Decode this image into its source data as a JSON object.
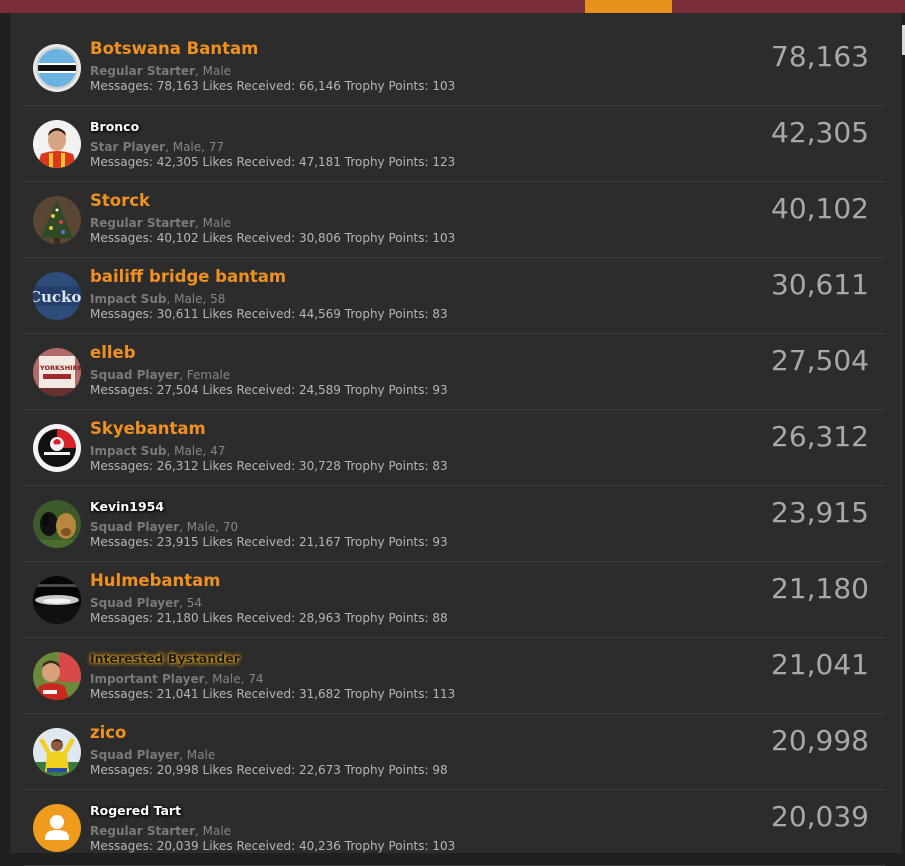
{
  "members": [
    {
      "name": "Botswana Bantam",
      "style": "plain",
      "rank": "Regular Starter",
      "details": ", Male",
      "stats": "Messages: 78,163 Likes Received: 66,146 Trophy Points: 103",
      "count": "78,163",
      "avatar": "botswana-flag"
    },
    {
      "name": "Bronco",
      "style": "white",
      "rank": "Star Player",
      "details": ", Male, 77",
      "stats": "Messages: 42,305 Likes Received: 47,181 Trophy Points: 123",
      "count": "42,305",
      "avatar": "portrait"
    },
    {
      "name": "Storck",
      "style": "plain",
      "rank": "Regular Starter",
      "details": ", Male",
      "stats": "Messages: 40,102 Likes Received: 30,806 Trophy Points: 103",
      "count": "40,102",
      "avatar": "christmas-tree"
    },
    {
      "name": "bailiff bridge bantam",
      "style": "plain",
      "rank": "Impact Sub",
      "details": ", Male, 58",
      "stats": "Messages: 30,611 Likes Received: 44,569 Trophy Points: 83",
      "count": "30,611",
      "avatar": "cuckoo-text",
      "avatar_text": "Cuckoo"
    },
    {
      "name": "elleb",
      "style": "plain",
      "rank": "Squad Player",
      "details": ", Female",
      "stats": "Messages: 27,504 Likes Received: 24,589 Trophy Points: 93",
      "count": "27,504",
      "avatar": "yorkshire-sign",
      "avatar_text": "YORKSHIRE"
    },
    {
      "name": "Skyebantam",
      "style": "plain",
      "rank": "Impact Sub",
      "details": ", Male, 47",
      "stats": "Messages: 26,312 Likes Received: 30,728 Trophy Points: 83",
      "count": "26,312",
      "avatar": "club-crest"
    },
    {
      "name": "Kevin1954",
      "style": "white",
      "rank": "Squad Player",
      "details": ", Male, 70",
      "stats": "Messages: 23,915 Likes Received: 21,167 Trophy Points: 93",
      "count": "23,915",
      "avatar": "dogs"
    },
    {
      "name": "Hulmebantam",
      "style": "plain",
      "rank": "Squad Player",
      "details": ", 54",
      "stats": "Messages: 21,180 Likes Received: 28,963 Trophy Points: 88",
      "count": "21,180",
      "avatar": "moonlit-sea"
    },
    {
      "name": "Interested Bystander",
      "style": "gold",
      "rank": "Important Player",
      "details": ", Male, 74",
      "stats": "Messages: 21,041 Likes Received: 31,682 Trophy Points: 113",
      "count": "21,041",
      "avatar": "football-fan"
    },
    {
      "name": "zico",
      "style": "plain",
      "rank": "Squad Player",
      "details": ", Male",
      "stats": "Messages: 20,998 Likes Received: 22,673 Trophy Points: 98",
      "count": "20,998",
      "avatar": "footballer"
    },
    {
      "name": "Rogered Tart",
      "style": "white",
      "rank": "Regular Starter",
      "details": ", Male",
      "stats": "Messages: 20,039 Likes Received: 40,236 Trophy Points: 103",
      "count": "20,039",
      "avatar": "default-user"
    }
  ]
}
